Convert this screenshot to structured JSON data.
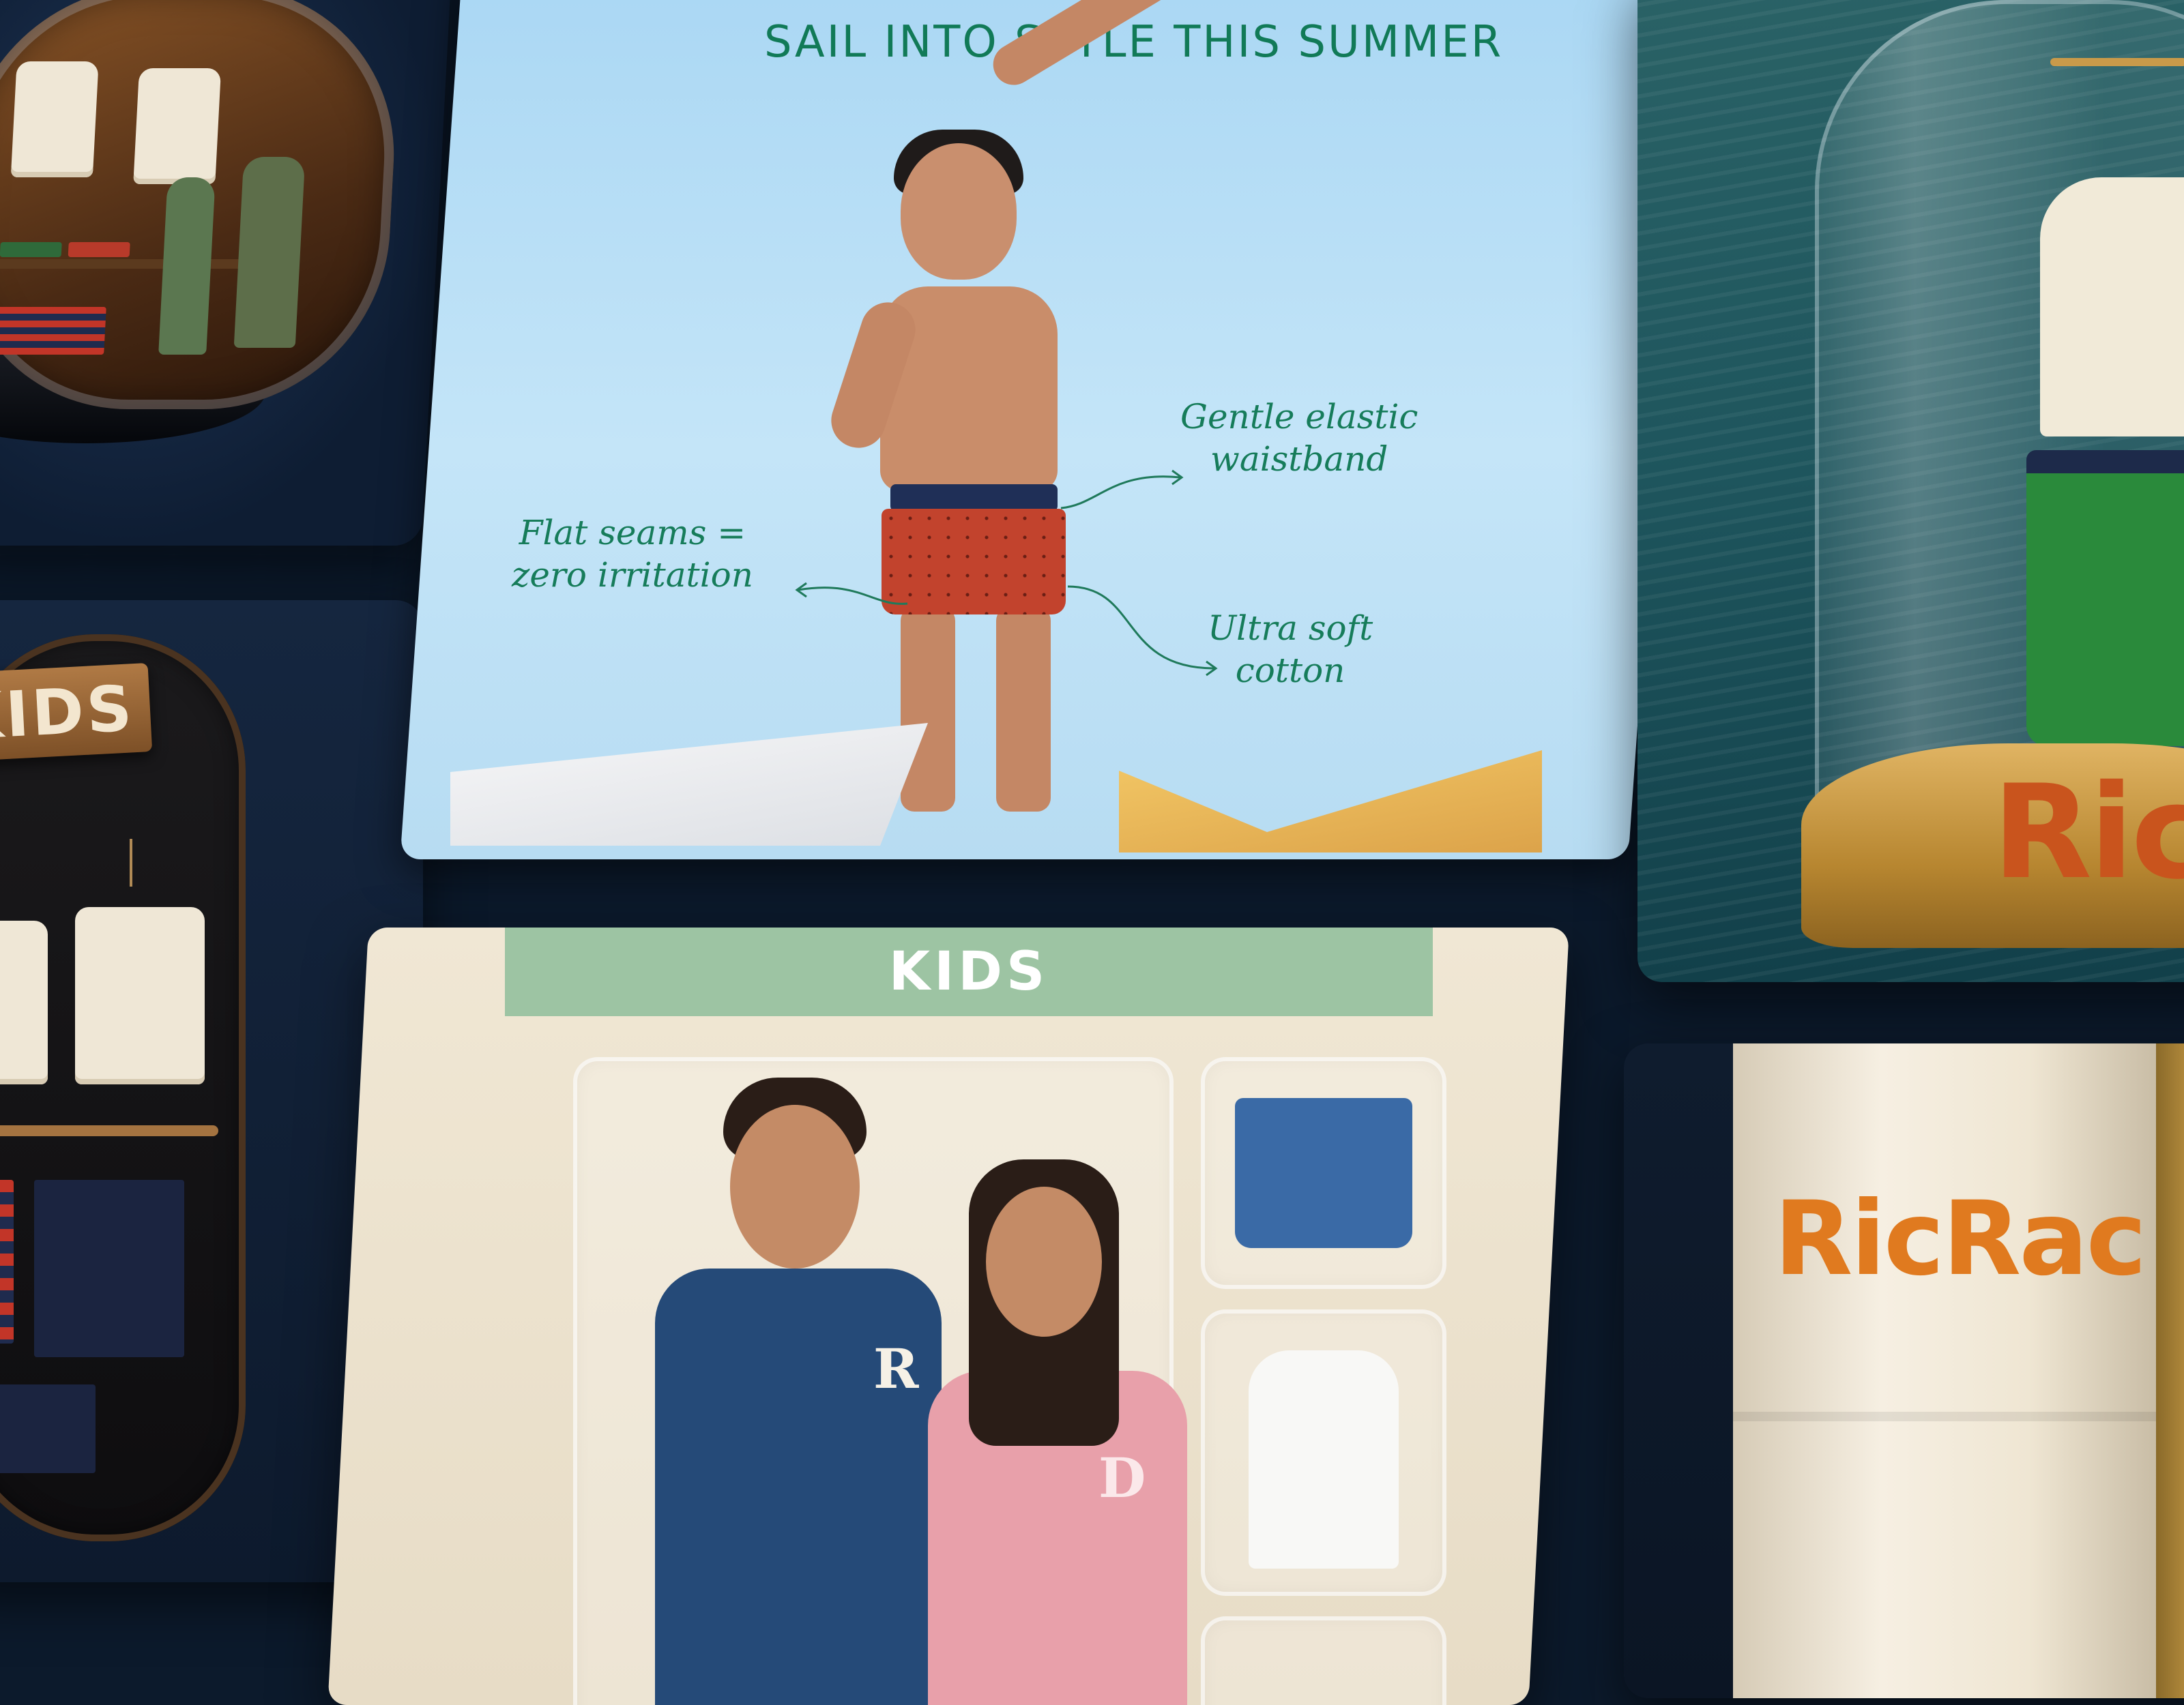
{
  "hero": {
    "headline": "SAIL INTO STYLE THIS SUMMER",
    "callouts": {
      "waistband_line1": "Gentle elastic",
      "waistband_line2": "waistband",
      "seams_line1": "Flat seams =",
      "seams_line2": "zero irritation",
      "cotton_line1": "Ultra soft",
      "cotton_line2": "cotton"
    }
  },
  "rail": {
    "sign_label": "KIDS"
  },
  "pack": {
    "band_label": "KIDS",
    "jacket_letter_boy": "R",
    "jacket_letter_girl": "D"
  },
  "ocean": {
    "brand_partial": "Ric"
  },
  "tube": {
    "brand": "RicRac"
  },
  "colors": {
    "background": "#0c1a2c",
    "hero_text": "#117a57",
    "brand_orange": "#e07a1f",
    "pack_band": "#9dc4a3"
  }
}
